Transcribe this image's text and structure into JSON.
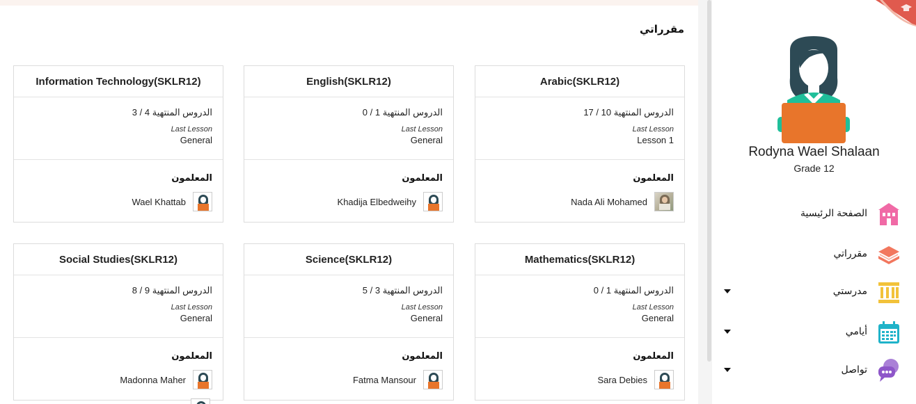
{
  "main": {
    "title": "مقرراتي",
    "progress_label": "الدروس المنتهية",
    "last_lesson_label": "Last Lesson",
    "teachers_label": "المعلمون",
    "courses": [
      {
        "name": "Arabic(SKLR12)",
        "progress_label": "الدروس المنتهية",
        "progress": "10 / 17",
        "last_lesson": "Lesson 1",
        "teacher": "Nada Ali Mohamed"
      },
      {
        "name": "English(SKLR12)",
        "progress_label": "الدروس المنتهية",
        "progress": "1 / 0",
        "last_lesson": "General",
        "teacher": "Khadija Elbedweihy"
      },
      {
        "name": "Information Technology(SKLR12)",
        "progress_label": "الدروس المنتهية",
        "progress": "4 / 3",
        "last_lesson": "General",
        "teacher": "Wael Khattab"
      },
      {
        "name": "Mathematics(SKLR12)",
        "progress_label": "الدروس المنتهية",
        "progress": "1 / 0",
        "last_lesson": "General",
        "teacher": "Sara Debies"
      },
      {
        "name": "Science(SKLR12)",
        "progress_label": "الدروس المنتهية",
        "progress": "3 / 5",
        "last_lesson": "General",
        "teacher": "Fatma Mansour"
      },
      {
        "name": "Social Studies(SKLR12)",
        "progress_label": "الدروس المنتهية",
        "progress": "9 / 8",
        "last_lesson": "General",
        "teacher": "Madonna Maher"
      }
    ]
  },
  "sidebar": {
    "user_name": "Rodyna Wael Shalaan",
    "grade": "Grade 12",
    "nav": [
      {
        "label": "الصفحة الرئيسية",
        "icon": "school-building-icon",
        "color": "#f06aa6",
        "has_caret": false
      },
      {
        "label": "مقرراتي",
        "icon": "books-stack-icon",
        "color": "#f2775e",
        "has_caret": false
      },
      {
        "label": "مدرستي",
        "icon": "institution-columns-icon",
        "color": "#f2c23a",
        "has_caret": true
      },
      {
        "label": "أيامي",
        "icon": "calendar-icon",
        "color": "#1fb3c9",
        "has_caret": true
      },
      {
        "label": "تواصل",
        "icon": "chat-bubbles-icon",
        "color": "#8e56c9",
        "has_caret": true
      }
    ]
  },
  "colors": {
    "accent_orange": "#e8752b",
    "avatar_dark": "#2d4a55",
    "avatar_teal": "#1fbf9a",
    "corner_red": "#e05a4e"
  }
}
